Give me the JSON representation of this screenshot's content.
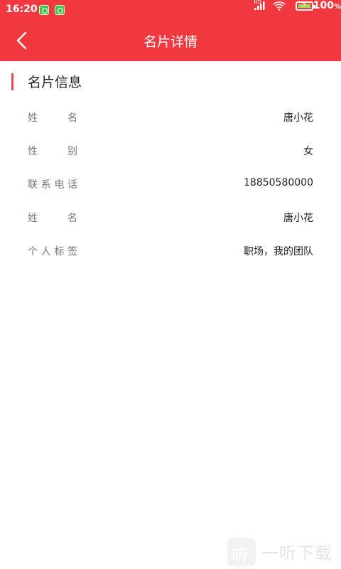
{
  "status": {
    "time": "16:20",
    "hd": "HD",
    "battery": "100",
    "battery_unit": "%"
  },
  "header": {
    "title": "名片详情",
    "back_icon": "chevron-left-icon"
  },
  "section": {
    "title": "名片信息"
  },
  "info": {
    "rows": [
      {
        "label_chars": [
          "姓",
          "名"
        ],
        "value": "唐小花"
      },
      {
        "label_chars": [
          "性",
          "别"
        ],
        "value": "女"
      },
      {
        "label_chars": [
          "联",
          "系",
          "电",
          "话"
        ],
        "value": "18850580000"
      },
      {
        "label_chars": [
          "姓",
          "名"
        ],
        "value": "唐小花"
      },
      {
        "label_chars": [
          "个",
          "人",
          "标",
          "签"
        ],
        "value": "职场，我的团队"
      }
    ]
  },
  "watermark": {
    "icon_text": "听",
    "text": "一听下载"
  },
  "colors": {
    "accent": "#f2393f",
    "section_bar": "#e74b4b",
    "label": "#777777",
    "value": "#222222"
  }
}
